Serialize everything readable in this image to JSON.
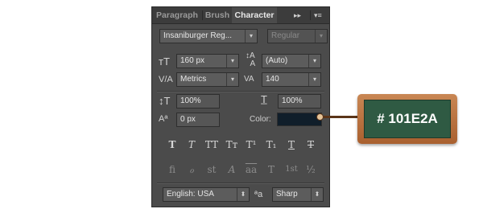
{
  "tabs": [
    {
      "label": "Paragraph",
      "active": false
    },
    {
      "label": "Brush",
      "active": false
    },
    {
      "label": "Character",
      "active": true
    }
  ],
  "panel_controls": {
    "collapse": "▸▸",
    "menu": "▾≡"
  },
  "font_family": "Insaniburger Reg...",
  "font_style": "Regular",
  "font_size": "160 px",
  "leading": "(Auto)",
  "kerning": "Metrics",
  "tracking": "140",
  "vertical_scale": "100%",
  "horizontal_scale": "100%",
  "baseline_shift": "0 px",
  "color_label": "Color:",
  "color_value": "#101E2A",
  "type_styles": [
    "T",
    "T",
    "TT",
    "Tт",
    "T¹",
    "T₁",
    "T",
    "T"
  ],
  "opentype_features": [
    "fi",
    "ℴ",
    "st",
    "A",
    "aa",
    "T",
    "1st",
    "½"
  ],
  "language": "English: USA",
  "antialias_label": "ªa",
  "antialias": "Sharp",
  "callout": "# 101E2A"
}
